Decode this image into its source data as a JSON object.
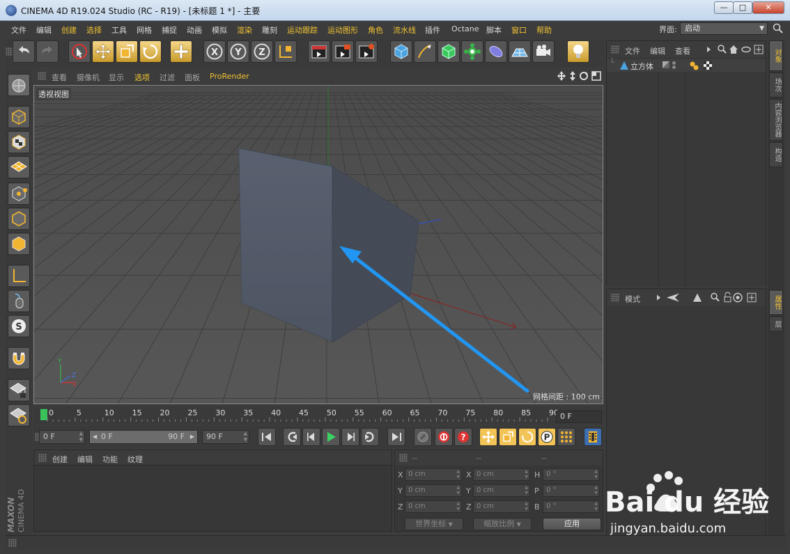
{
  "window": {
    "title": "CINEMA 4D R19.024 Studio (RC - R19) - [未标题 1 *] - 主要",
    "minimize": "—",
    "maximize": "□",
    "close": "✕"
  },
  "menubar": {
    "items": [
      "文件",
      "编辑",
      "创建",
      "选择",
      "工具",
      "网格",
      "捕捉",
      "动画",
      "模拟",
      "渲染",
      "雕刻",
      "运动跟踪",
      "运动图形",
      "角色",
      "流水线",
      "插件",
      "Octane",
      "脚本",
      "窗口",
      "帮助"
    ],
    "interface_label": "界面:",
    "interface_value": "启动"
  },
  "toolbar": {
    "icons": [
      "undo-icon",
      "redo-icon",
      "live-select-icon",
      "move-icon",
      "scale-icon",
      "rotate-icon",
      "add-icon",
      "x-axis-icon",
      "y-axis-icon",
      "z-axis-icon",
      "coordinate-system-icon",
      "render-view-icon",
      "render-picture-viewer-icon",
      "render-settings-icon",
      "cube-primitive-icon",
      "pen-spline-icon",
      "subdivision-surface-icon",
      "array-generator-icon",
      "deformer-icon",
      "floor-scene-icon",
      "camera-icon",
      "light-icon"
    ],
    "axis_x": "X",
    "axis_y": "Y",
    "axis_z": "Z"
  },
  "viewport": {
    "menu": [
      "查看",
      "摄像机",
      "显示",
      "选项",
      "过滤",
      "面板",
      "ProRender"
    ],
    "label": "透视视图",
    "grid_spacing": "网格间距 : 100 cm",
    "axis_labels": {
      "y": "Y",
      "z": "Z",
      "x": "X"
    }
  },
  "timeline": {
    "ticks": [
      "0",
      "5",
      "10",
      "15",
      "20",
      "25",
      "30",
      "35",
      "40",
      "45",
      "50",
      "55",
      "60",
      "65",
      "70",
      "75",
      "80",
      "85",
      "90"
    ],
    "current_frame": "0 F"
  },
  "transport": {
    "start_frame": "0 F",
    "range_start": "0 F",
    "range_end": "90 F",
    "end_frame": "90 F"
  },
  "material_panel": {
    "menu": [
      "创建",
      "编辑",
      "功能",
      "纹理"
    ]
  },
  "coord_panel": {
    "headers": [
      "--",
      "--",
      "--"
    ],
    "rows": [
      {
        "l1": "X",
        "v1": "0 cm",
        "l2": "X",
        "v2": "0 cm",
        "l3": "H",
        "v3": "0 °"
      },
      {
        "l1": "Y",
        "v1": "0 cm",
        "l2": "Y",
        "v2": "0 cm",
        "l3": "P",
        "v3": "0 °"
      },
      {
        "l1": "Z",
        "v1": "0 cm",
        "l2": "Z",
        "v2": "0 cm",
        "l3": "B",
        "v3": "0 °"
      }
    ],
    "world_coords": "世界坐标",
    "scale_ratio": "缩放比例",
    "apply": "应用"
  },
  "object_panel": {
    "menu": [
      "文件",
      "编辑",
      "查看"
    ],
    "object_name": "立方体"
  },
  "attr_panel": {
    "mode": "模式"
  },
  "right_tabs": {
    "top": [
      "对象",
      "场次",
      "内容浏览器",
      "构造"
    ],
    "bottom": [
      "属性",
      "层"
    ]
  },
  "brand": {
    "maxon": "MAXON",
    "cinema": "CINEMA 4D"
  },
  "watermark": {
    "text": "Bai du 经验",
    "url": "jingyan.baidu.com"
  },
  "colors": {
    "accent": "#f1c232",
    "arrow": "#2196f3",
    "viewport": "#505050",
    "cube": "#4b5260"
  }
}
